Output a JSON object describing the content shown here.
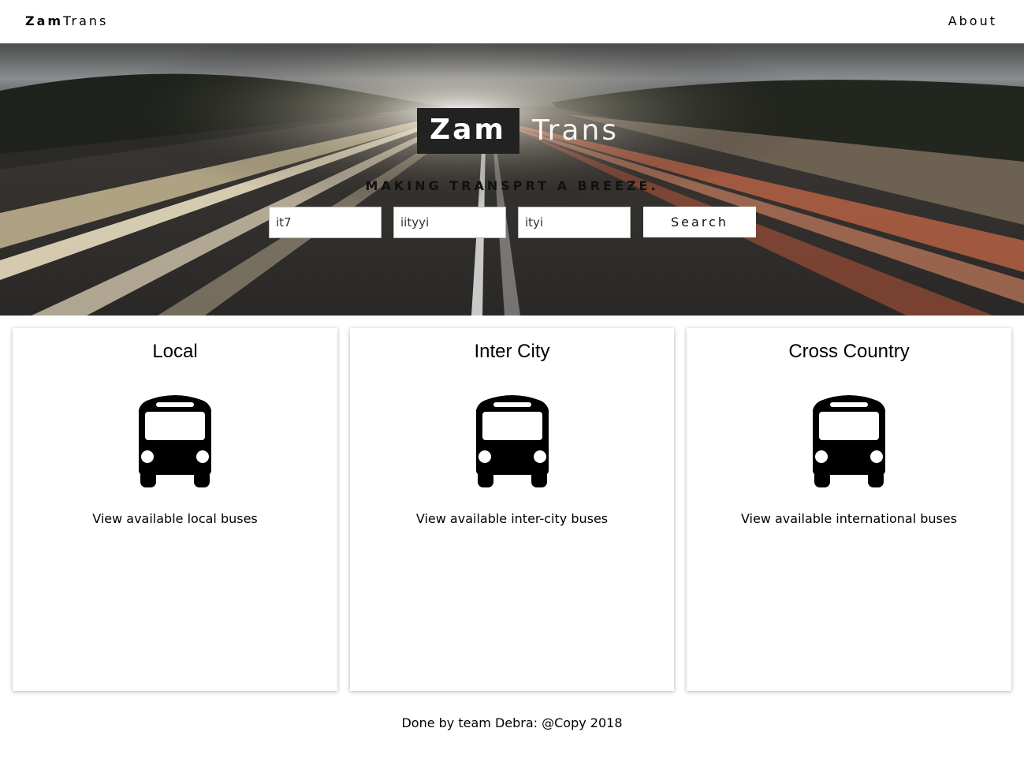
{
  "nav": {
    "brand_bold": "Zam",
    "brand_rest": "Trans",
    "about_label": "About"
  },
  "hero": {
    "title_box": "Zam",
    "title_rest": "Trans",
    "tagline": "MAKING TRANSPRT A BREEZE.",
    "inputs": [
      "it7",
      "iityyi",
      "ityi"
    ],
    "search_label": "Search"
  },
  "cards": [
    {
      "title": "Local",
      "icon": "bus-icon",
      "text": "View available local buses"
    },
    {
      "title": "Inter City",
      "icon": "bus-icon",
      "text": "View available inter-city buses"
    },
    {
      "title": "Cross Country",
      "icon": "bus-icon",
      "text": "View available international buses"
    }
  ],
  "footer": {
    "text": "Done by team Debra: @Copy 2018"
  }
}
